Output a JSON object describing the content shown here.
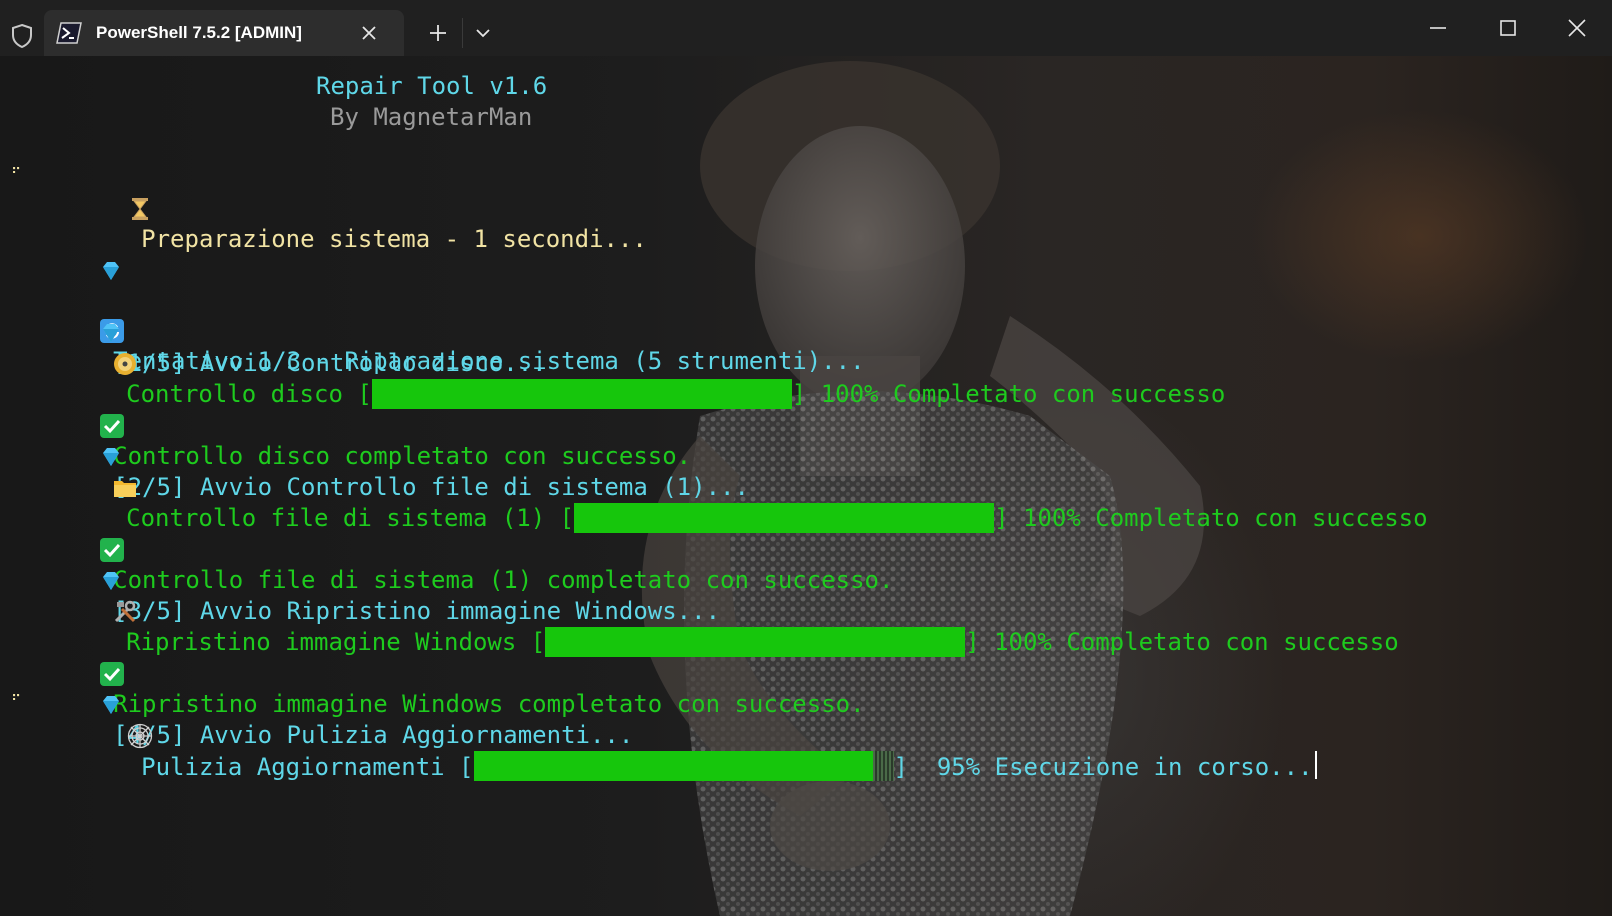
{
  "titlebar": {
    "tab_title": "PowerShell 7.5.2 [ADMIN]",
    "icons": [
      "shield-icon",
      "powershell-icon",
      "close-icon",
      "plus-icon",
      "chevron-down-icon",
      "minimize-icon",
      "maximize-icon",
      "window-close-icon"
    ]
  },
  "header": {
    "title": "Repair Tool v1.6",
    "subtitle": "By MagnetarMan"
  },
  "lines": {
    "prep": "Preparazione sistema - 1 secondi...",
    "attempt": "Tentativo 1/3 - Riparazione sistema (5 strumenti)...",
    "step1_start": "[1/5] Avvio Controllo disco...",
    "step1_label": "Controllo disco [",
    "step1_tail": "] 100% Completato con successo",
    "step1_done": "Controllo disco completato con successo.",
    "step2_start": "[2/5] Avvio Controllo file di sistema (1)...",
    "step2_label": "Controllo file di sistema (1) [",
    "step2_tail": "] 100% Completato con successo",
    "step2_done": "Controllo file di sistema (1) completato con successo.",
    "step3_start": "[3/5] Avvio Ripristino immagine Windows...",
    "step3_label": "Ripristino immagine Windows [",
    "step3_tail": "] 100% Completato con successo",
    "step3_done": "Ripristino immagine Windows completato con successo.",
    "step4_start": "[4/5] Avvio Pulizia Aggiornamenti...",
    "step4_label": "Pulizia Aggiornamenti [",
    "step4_tail": "]  95% Esecuzione in corso..."
  },
  "progress": {
    "step1": 1.0,
    "step2": 1.0,
    "step3": 1.0,
    "step4": 0.95
  },
  "colors": {
    "cyan": "#5fd7e8",
    "yellow": "#f1e3a4",
    "green": "#1ecb1e",
    "bar": "#16c60c"
  }
}
